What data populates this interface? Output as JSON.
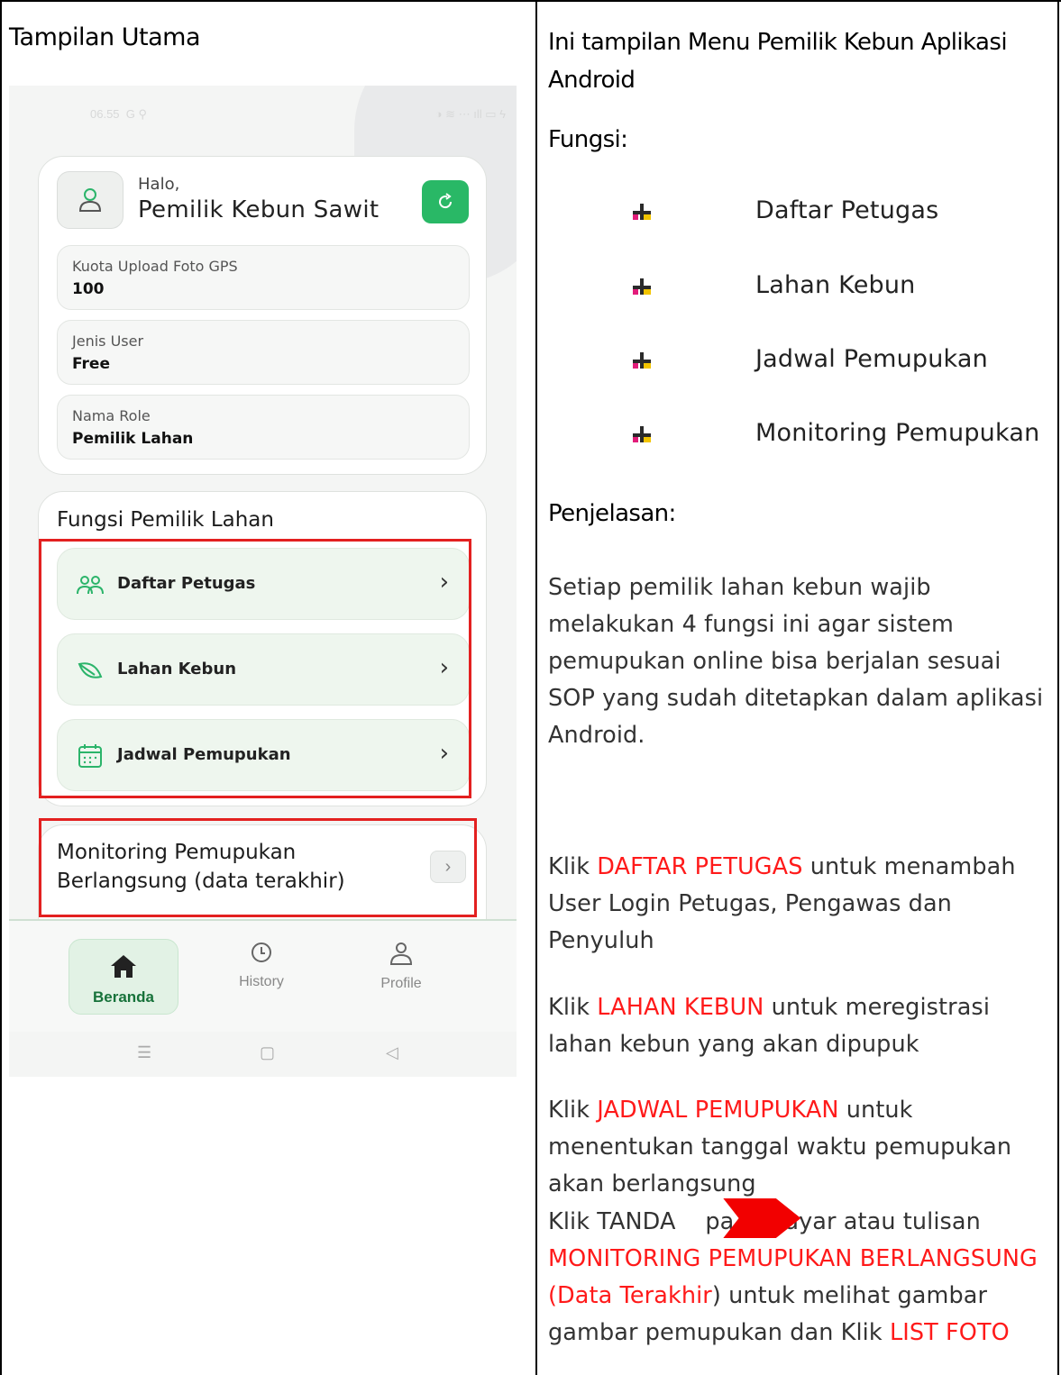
{
  "left_header": "Tampilan Utama",
  "phone": {
    "status_time": "06.55",
    "status_icons": "G ⚲",
    "status_right": "◑ ≋ ⋯ ıll ▭ ϟ",
    "greeting": "Halo,",
    "owner_name": "Pemilik Kebun Sawit",
    "info": [
      {
        "label": "Kuota Upload Foto GPS",
        "value": "100"
      },
      {
        "label": "Jenis User",
        "value": "Free"
      },
      {
        "label": "Nama Role",
        "value": "Pemilik Lahan"
      }
    ],
    "functions_title": "Fungsi Pemilik Lahan",
    "menu": [
      {
        "label": "Daftar Petugas",
        "icon": "users-icon"
      },
      {
        "label": "Lahan Kebun",
        "icon": "leaf-icon"
      },
      {
        "label": "Jadwal Pemupukan",
        "icon": "calendar-icon"
      }
    ],
    "monitoring_title_1": "Monitoring Pemupukan",
    "monitoring_title_2": "Berlangsung (data terakhir)",
    "nav": {
      "home": "Beranda",
      "history": "History",
      "profile": "Profile"
    },
    "accent_color": "#29b866",
    "highlight_color": "#e32020"
  },
  "right": {
    "title_line1": "Ini tampilan Menu Pemilik Kebun Aplikasi",
    "title_line2": "Android",
    "fungsi_heading": "Fungsi:",
    "functions": [
      "Daftar Petugas",
      "Lahan Kebun",
      "Jadwal Pemupukan",
      "Monitoring Pemupukan"
    ],
    "penjelasan_heading": "Penjelasan:",
    "intro": [
      "Setiap pemilik lahan kebun wajib",
      "melakukan 4 fungsi ini agar sistem",
      "pemupukan online bisa berjalan sesuai",
      "SOP yang sudah ditetapkan dalam aplikasi",
      "Android."
    ],
    "p1": {
      "pre": "Klik ",
      "red": "DAFTAR PETUGAS",
      "post": " untuk menambah",
      "line2": "User Login Petugas, Pengawas dan",
      "line3": "Penyuluh"
    },
    "p2": {
      "pre": "Klik ",
      "red": "LAHAN KEBUN",
      "post": " untuk meregistrasi",
      "line2": "lahan kebun yang akan dipupuk"
    },
    "p3": {
      "pre": "Klik ",
      "red": "JADWAL PEMUPUKAN",
      "post": " untuk",
      "line2": "menentukan tanggal waktu pemupukan",
      "line3": "akan berlangsung"
    },
    "p4": {
      "pre": "Klik TANDA    pa",
      "mid": "ayar atau tulisan",
      "red_line": "MONITORING PEMUPUKAN BERLANGSUNG",
      "red_paren": "(Data Terakhir",
      "post_paren": ") untuk melihat gambar",
      "line4_pre": "gambar pemupukan dan Klik ",
      "line4_red": "LIST FOTO"
    }
  }
}
